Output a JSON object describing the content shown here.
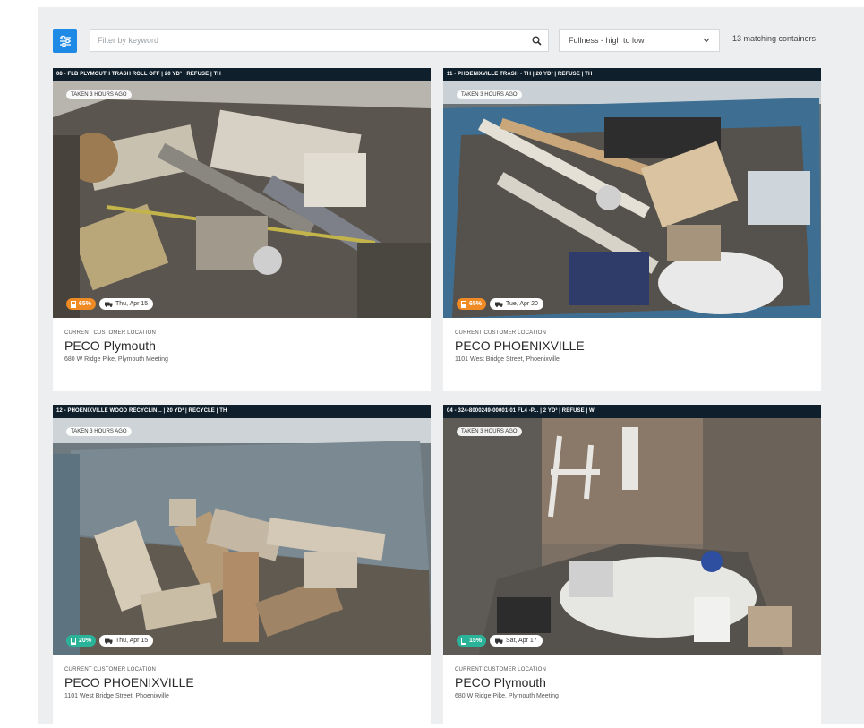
{
  "toolbar": {
    "search_placeholder": "Filter by keyword",
    "sort_value": "Fullness - high to low",
    "match_count": "13 matching containers"
  },
  "colors": {
    "accent": "#1f8ae6",
    "header_bg": "#0f1f2b",
    "fill_high": "#f08a24",
    "fill_low": "#2bb39a"
  },
  "cards": [
    {
      "header": "08 - FLB PLYMOUTH TRASH ROLL OFF | 20 YD³ | REFUSE | TH",
      "taken": "TAKEN 3 HOURS AGO",
      "fill_pct": "65%",
      "date": "Thu, Apr 15",
      "loc_label": "CURRENT CUSTOMER LOCATION",
      "loc_name": "PECO Plymouth",
      "loc_addr": "680 W Ridge Pike, Plymouth Meeting"
    },
    {
      "header": "11 - PHOENIXVILLE TRASH - TH | 20 YD³ | REFUSE | TH",
      "taken": "TAKEN 3 HOURS AGO",
      "fill_pct": "65%",
      "date": "Tue, Apr 20",
      "loc_label": "CURRENT CUSTOMER LOCATION",
      "loc_name": "PECO PHOENIXVILLE",
      "loc_addr": "1101 West Bridge Street, Phoenixville"
    },
    {
      "header": "12 - PHOENIXVILLE WOOD RECYCLIN... | 20 YD³ | RECYCLE | TH",
      "taken": "TAKEN 3 HOURS AGO",
      "fill_pct": "20%",
      "date": "Thu, Apr 15",
      "loc_label": "CURRENT CUSTOMER LOCATION",
      "loc_name": "PECO PHOENIXVILLE",
      "loc_addr": "1101 West Bridge Street, Phoenixville"
    },
    {
      "header": "04 - 324-8000249-00001-01 FL4 -P... | 2 YD³ | REFUSE | W",
      "taken": "TAKEN 3 HOURS AGO",
      "fill_pct": "15%",
      "date": "Sat, Apr 17",
      "loc_label": "CURRENT CUSTOMER LOCATION",
      "loc_name": "PECO Plymouth",
      "loc_addr": "680 W Ridge Pike, Plymouth Meeting"
    }
  ]
}
